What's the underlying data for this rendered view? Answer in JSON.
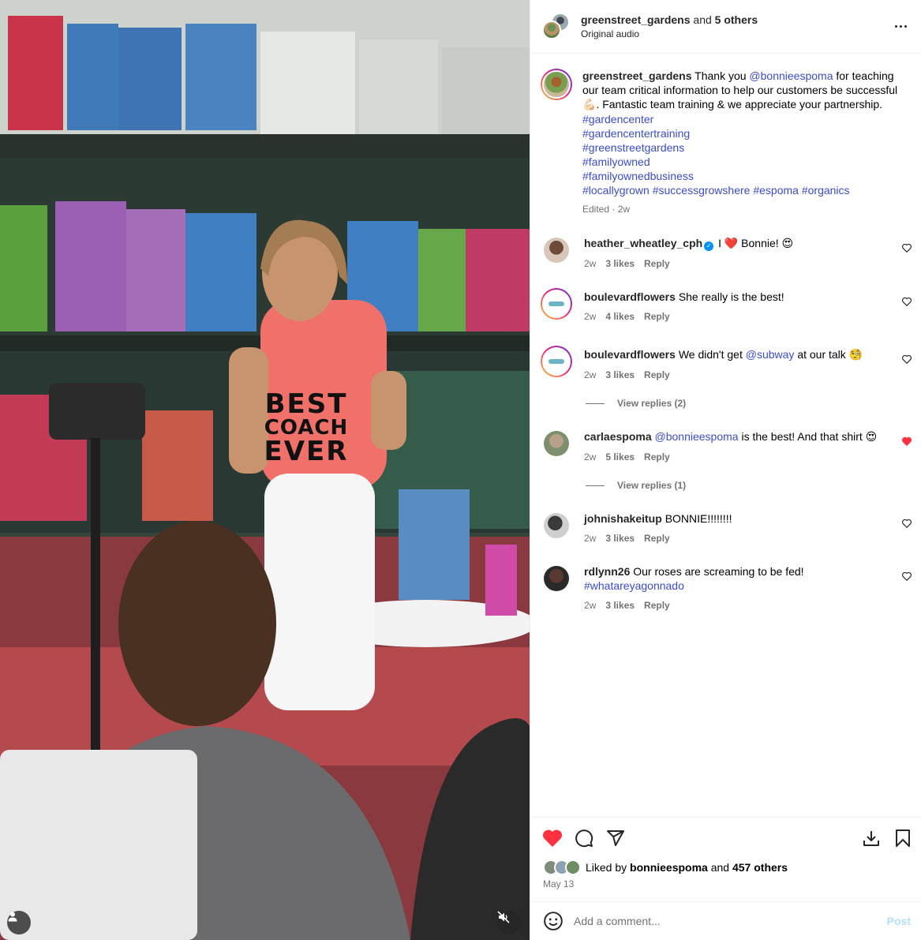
{
  "header": {
    "username": "greenstreet_gardens",
    "and_text": "and",
    "others": "5 others",
    "audio": "Original audio"
  },
  "shirt_text": [
    "BEST",
    "COACH",
    "EVER"
  ],
  "caption": {
    "username": "greenstreet_gardens",
    "text_1": "Thank you",
    "mention": "@bonnieespoma",
    "text_2": "for teaching our team critical information to help our customers be successful",
    "emoji": "💪🏻",
    "text_3": ". Fantastic team training & we appreciate your partnership.",
    "hashtags": [
      "#gardencenter",
      "#gardencentertraining",
      "#greenstreetgardens",
      "#familyowned",
      "#familyownedbusiness"
    ],
    "last_line": [
      "#locallygrown",
      "#successgrowshere",
      "#espoma",
      "#organics"
    ],
    "edited": "Edited",
    "time": "2w"
  },
  "comments": [
    {
      "username": "heather_wheatley_cph",
      "verified": true,
      "text_a": "I",
      "heart": "❤️",
      "text_b": "Bonnie!",
      "emoji": "😍",
      "time": "2w",
      "likes": "3 likes",
      "reply": "Reply",
      "liked": false
    },
    {
      "username": "boulevardflowers",
      "text": "She really is the best!",
      "time": "2w",
      "likes": "4 likes",
      "reply": "Reply",
      "liked": false
    },
    {
      "username": "boulevardflowers",
      "text_a": "We didn't get",
      "mention": "@subway",
      "text_b": "at our talk",
      "emoji": "🧐",
      "time": "2w",
      "likes": "3 likes",
      "reply": "Reply",
      "liked": false,
      "view_replies": "View replies (2)"
    },
    {
      "username": "carlaespoma",
      "mention": "@bonnieespoma",
      "text": "is the best! And that shirt",
      "emoji": "😍",
      "time": "2w",
      "likes": "5 likes",
      "reply": "Reply",
      "liked": true,
      "view_replies": "View replies (1)"
    },
    {
      "username": "johnishakeitup",
      "text": "BONNIE!!!!!!!!",
      "time": "2w",
      "likes": "3 likes",
      "reply": "Reply",
      "liked": false
    },
    {
      "username": "rdlynn26",
      "text": "Our roses are screaming to be fed!",
      "hashtag": "#whatareyagonnado",
      "time": "2w",
      "likes": "3 likes",
      "reply": "Reply",
      "liked": false
    }
  ],
  "likes": {
    "liked_by": "Liked by",
    "user": "bonnieespoma",
    "and": "and",
    "others": "457 others",
    "date": "May 13"
  },
  "add_comment": {
    "placeholder": "Add a comment...",
    "post": "Post"
  },
  "colors": {
    "link": "#3b4cca",
    "like_red": "#ff3040",
    "post_disabled": "#b2dffc"
  }
}
